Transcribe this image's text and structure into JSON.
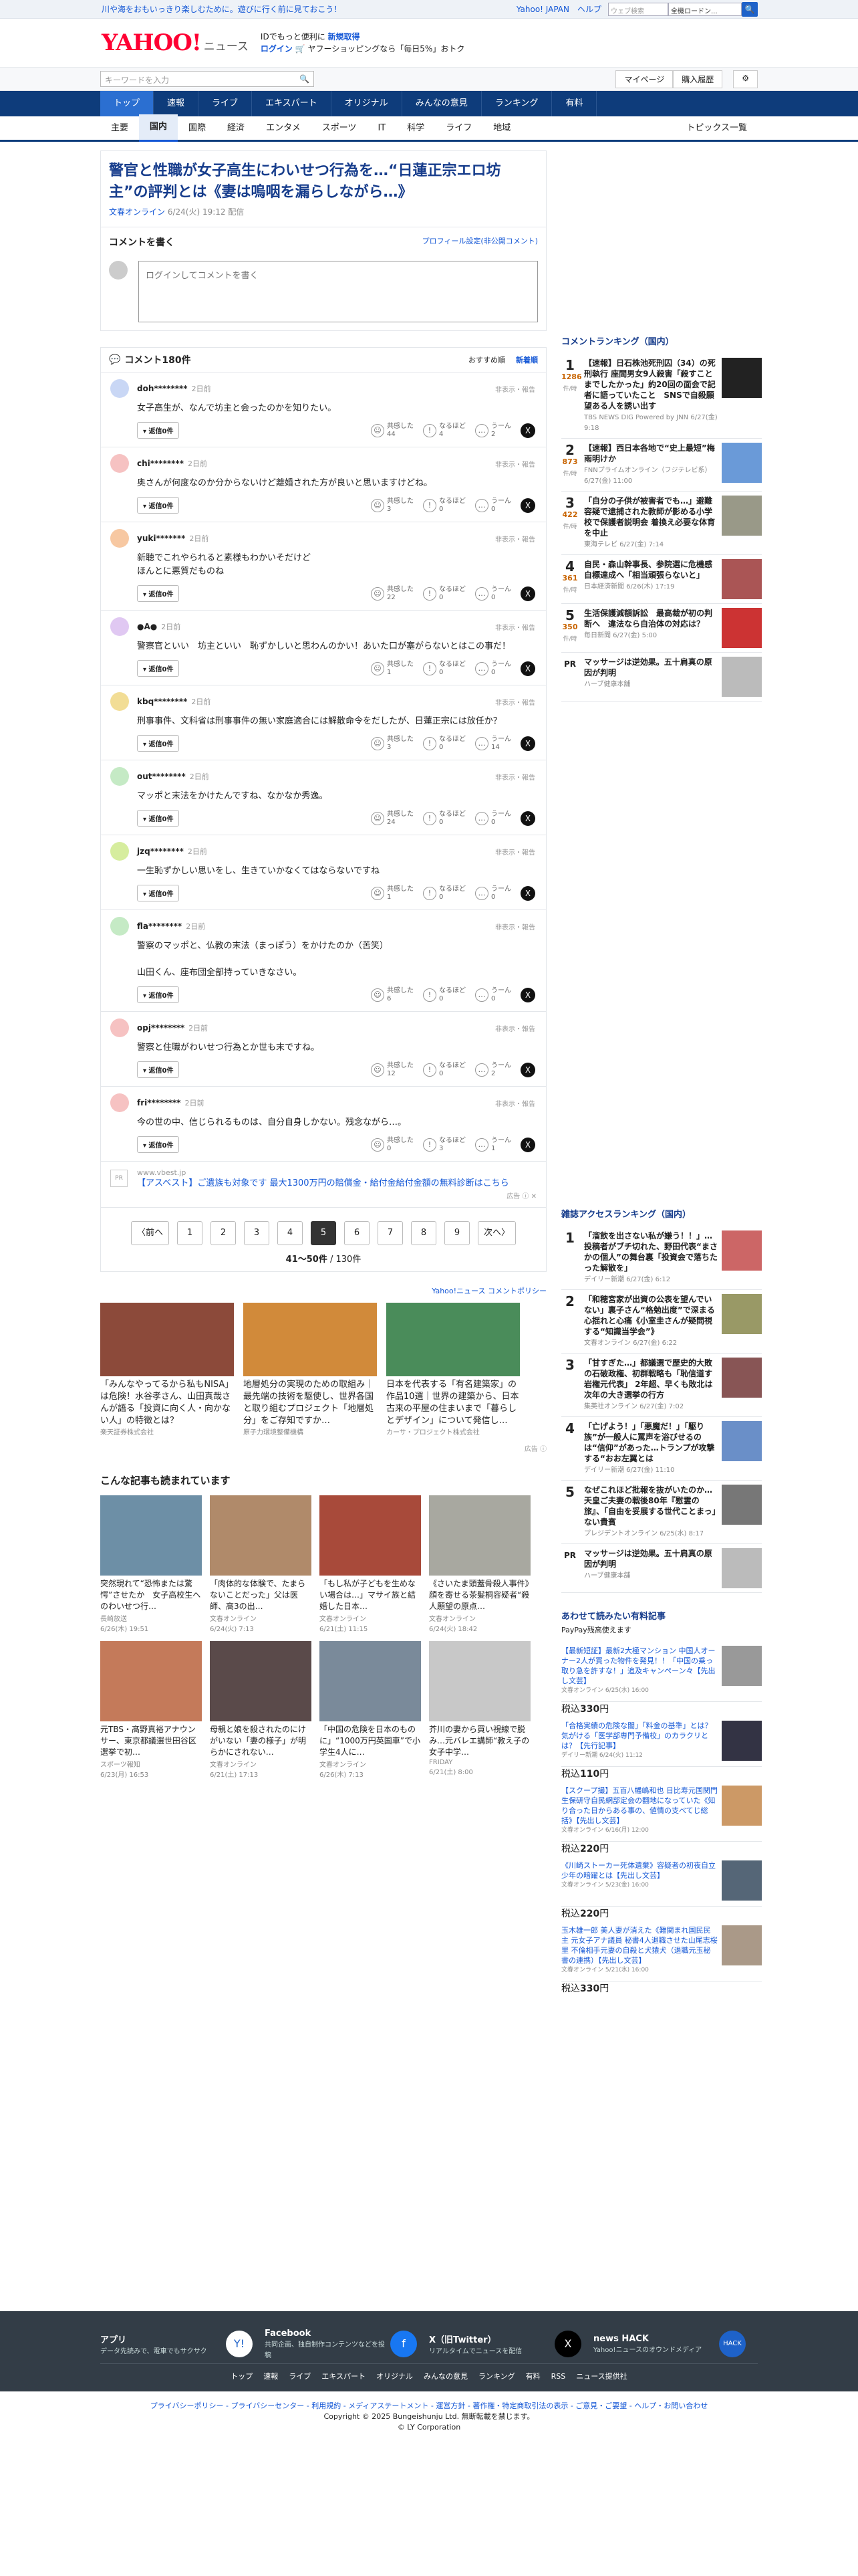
{
  "topbar": {
    "promo": "川や海をおもいっきり楽しむために。遊びに行く前に見ておこう！",
    "links": [
      "Yahoo! JAPAN",
      "ヘルプ"
    ],
    "search_placeholder": "ウェブ検索",
    "select": "全機ロードン...",
    "btn": "🔍"
  },
  "header": {
    "logo": "YAHOO!",
    "logo_sub": "JAPAN",
    "service": "ニュース",
    "line1a": "IDでもっと便利に",
    "line1b": "新規取得",
    "line2a": "ログイン",
    "line2b": "🛒 ヤフーショッピングなら「毎日5%」おトク"
  },
  "searchbar": {
    "placeholder": "キーワードを入力",
    "right": [
      "マイページ",
      "購入履歴",
      "⚙"
    ]
  },
  "gnav": [
    "トップ",
    "速報",
    "ライブ",
    "エキスパート",
    "オリジナル",
    "みんなの意見",
    "ランキング",
    "有料"
  ],
  "snav": [
    "主要",
    "国内",
    "国際",
    "経済",
    "エンタメ",
    "スポーツ",
    "IT",
    "科学",
    "ライフ",
    "地域"
  ],
  "snav_right": "トピックス一覧",
  "article": {
    "title": "警官と性職が女子高生にわいせつ行為を…“日蓮正宗エロ坊主”の評判とは《妻は嗚咽を漏らしながら…》",
    "source": "文春オンライン",
    "date": "6/24(火) 19:12 配信"
  },
  "comment_write": {
    "title": "コメントを書く",
    "profile": "プロフィール設定(非公開コメント)",
    "placeholder": "ログインしてコメントを書く"
  },
  "comments_header": {
    "title": "コメント180件",
    "sort1": "おすすめ順",
    "sort2": "新着順"
  },
  "comments": [
    {
      "user": "doh********",
      "time": "2日前",
      "body": "女子高生が、なんで坊主と会ったのかを知りたい。",
      "likes": "44",
      "agree": "4",
      "hmm": "2",
      "color": "#c9d7f5"
    },
    {
      "user": "chi********",
      "time": "2日前",
      "body": "奥さんが何度なのか分からないけど離婚された方が良いと思いますけどね。",
      "likes": "3",
      "agree": "0",
      "hmm": "0",
      "color": "#f6c2c2"
    },
    {
      "user": "yuki*******",
      "time": "2日前",
      "body": "新聴でこれやられると素様もわかいそだけど\nほんとに悪質だものね",
      "likes": "22",
      "agree": "0",
      "hmm": "0",
      "color": "#f7c8a2"
    },
    {
      "user": "●A●",
      "time": "2日前",
      "body": "警察官といい　坊主といい　恥ずかしいと思わんのかい！あいた口が塞がらないとはこの事だ！",
      "likes": "1",
      "agree": "0",
      "hmm": "0",
      "color": "#e0c8f2"
    },
    {
      "user": "kbq********",
      "time": "2日前",
      "body": "刑事事件、文科省は刑事事件の無い家庭適合には解散命令をだしたが、日蓮正宗には放任か？",
      "likes": "3",
      "agree": "0",
      "hmm": "14",
      "color": "#f2dd95"
    },
    {
      "user": "out********",
      "time": "2日前",
      "body": "マッポと末法をかけたんですね、なかなか秀逸。",
      "likes": "24",
      "agree": "0",
      "hmm": "0",
      "color": "#c5eac5"
    },
    {
      "user": "jzq********",
      "time": "2日前",
      "body": "一生恥ずかしい思いをし、生きていかなくてはならないですね",
      "likes": "1",
      "agree": "0",
      "hmm": "0",
      "color": "#d6ed9e"
    },
    {
      "user": "fla********",
      "time": "2日前",
      "body": "警察のマッポと、仏教の末法（まっぽう）をかけたのか（苦笑）\n\n山田くん、座布団全部持っていきなさい。",
      "likes": "6",
      "agree": "0",
      "hmm": "0",
      "color": "#c5eac5"
    },
    {
      "user": "opj********",
      "time": "2日前",
      "body": "警察と住職がわいせつ行為とか世も末ですね。",
      "likes": "12",
      "agree": "0",
      "hmm": "2",
      "color": "#f6c2c2"
    },
    {
      "user": "fri********",
      "time": "2日前",
      "body": "今の世の中、信じられるものは、自分自身しかない。残念ながら…。",
      "likes": "0",
      "agree": "3",
      "hmm": "1",
      "color": "#f6c2c2"
    }
  ],
  "comment_ui": {
    "reply": "返信0件",
    "report": "非表示・報告",
    "like": "共感した",
    "agree": "なるほど",
    "hmm": "うーん",
    "x": "X"
  },
  "ad1": {
    "pr": "PR",
    "domain": "www.vbest.jp",
    "title": "【アスベスト】ご遺族も対象です 最大1300万円の賠償金・給付金給付金額の無料診断はこちら",
    "label": "広告 ⓘ ✕"
  },
  "pager": {
    "pages": [
      "〈前へ",
      "1",
      "2",
      "3",
      "4",
      "5",
      "6",
      "7",
      "8",
      "9",
      "次へ〉"
    ],
    "current": "5",
    "count_a": "41〜50件",
    "count_b": " / 130件"
  },
  "policy": "Yahoo!ニュース コメントポリシー",
  "ads": [
    {
      "title": "「みんなやってるから私もNISA」は危険！水谷孝さん、山田真哉さんが語る「投資に向く人・向かない人」の特徴とは？",
      "src": "楽天証券株式会社",
      "c": "#8c4a3a"
    },
    {
      "title": "地層処分の実現のための取組み｜最先端の技術を駆使し、世界各国と取り組むプロジェクト「地層処分」をご存知ですか…",
      "src": "原子力環境整備機構",
      "c": "#d18a3a"
    },
    {
      "title": "日本を代表する「有名建築家」の作品10選｜世界の建築から、日本古来の平屋の住まいまで「暮らしとデザイン」について発信し…",
      "src": "カーサ・プロジェクト株式会社",
      "c": "#4a8c5a"
    }
  ],
  "ads_label": "広告 ⓘ",
  "related_title": "こんな記事も読まれています",
  "related": [
    {
      "t": "突然現れて“恐怖または驚愕”させたか　女子高校生へのわいせつ行…",
      "s": "長崎放送",
      "d": "6/26(木) 19:51",
      "c": "#6d8fa6"
    },
    {
      "t": "「肉体的な体験で、たまらないことだった」父は医師、高3の出…",
      "s": "文春オンライン",
      "d": "6/24(火) 7:13",
      "c": "#b08a6a"
    },
    {
      "t": "「もし私が子どもを生めない場合は…」マサイ族と結婚した日本…",
      "s": "文春オンライン",
      "d": "6/21(土) 11:15",
      "c": "#a84a3a"
    },
    {
      "t": "《さいたま頭蓋骨殺人事件》顔を寄せる茶髪桐容疑者“殺人願望の原点…",
      "s": "文春オンライン",
      "d": "6/24(火) 18:42",
      "c": "#a8a8a0"
    },
    {
      "t": "元TBS・髙野真裕アナウンサー、東京都議選世田谷区選挙で初…",
      "s": "スポーツ報知",
      "d": "6/23(月) 16:53",
      "c": "#c47a5a"
    },
    {
      "t": "母親と娘を殺されたのにけがいない「妻の様子」が明らかにされない…",
      "s": "文春オンライン",
      "d": "6/21(土) 17:13",
      "c": "#5a4a4a"
    },
    {
      "t": "「中国の危険を日本のものに」“1000万円英国車”で小学生4人に…",
      "s": "文春オンライン",
      "d": "6/26(木) 7:13",
      "c": "#7a8a9a"
    },
    {
      "t": "芥川の妻から買い視線で脱み…元バレエ講師“教え子の女子中学…",
      "s": "FRIDAY",
      "d": "6/21(土) 8:00",
      "c": "#c8c8c8"
    }
  ],
  "rank1": {
    "title": "コメントランキング（国内）",
    "items": [
      {
        "n": "1",
        "c": "1286",
        "u": "件/時",
        "t": "【速報】日石株池死刑囚（34）の死刑執行 座間男女9人殺害「殺すことまでしたかった」約20回の面会で記者に語っていたこと　SNSで自殺願望ある人を誘い出す",
        "s": "TBS NEWS DIG Powered by JNN 6/27(金) 9:18",
        "th": "#222"
      },
      {
        "n": "2",
        "c": "873",
        "u": "件/時",
        "t": "【速報】西日本各地で“史上最短”梅雨明けか",
        "s": "FNNプライムオンライン（フジテレビ系） 6/27(金) 11:00",
        "th": "#6a9ad8"
      },
      {
        "n": "3",
        "c": "422",
        "u": "件/時",
        "t": "「自分の子供が被害者でも…」避難容疑で逮捕された教師が影める小学校で保護者説明会 着換え必要な体育を中止",
        "s": "東海テレビ 6/27(金) 7:14",
        "th": "#998"
      },
      {
        "n": "4",
        "c": "361",
        "u": "件/時",
        "t": "自民・森山幹事長、参院選に危機感　自標達成へ「相当頑張らないと」",
        "s": "日本経済新聞 6/26(木) 17:19",
        "th": "#a55"
      },
      {
        "n": "5",
        "c": "350",
        "u": "件/時",
        "t": "生活保護減額訴訟　最高裁が初の判断へ　違法なら自治体の対応は？",
        "s": "毎日新聞 6/27(金) 5:00",
        "th": "#c33"
      }
    ],
    "pr": {
      "t": "マッサージは逆効果。五十肩真の原因が判明",
      "s": "ハーブ健康本舗",
      "th": "#bbb"
    }
  },
  "rank2": {
    "title": "雑誌アクセスランキング（国内）",
    "items": [
      {
        "n": "1",
        "t": "「溜飲を出さない私が嫌う！！」…投稿者がブチ切れた、野田代表“まさかの個人”の舞台裏「投資会で落ちたった解散を」",
        "s": "デイリー新潮 6/27(金) 6:12",
        "th": "#c66"
      },
      {
        "n": "2",
        "t": "「和穂宮家が出資の公表を望んでいない」裏子さん“格勉出度”で深まる心揺れと心痛《小室圭さんが疑問視する“知識当学会”》",
        "s": "文春オンライン 6/27(金) 6:22",
        "th": "#996"
      },
      {
        "n": "3",
        "t": "「甘すぎた…」都議選で歴史的大敗の石破政権、初群戦略も「恥信道す岩権元代表」 2年超、早くも敗北は次年の大き選挙の行方",
        "s": "集英社オンライン 6/27(金) 7:02",
        "th": "#855"
      },
      {
        "n": "4",
        "t": "「亡げよう！」「悪魔だ！」「駆り族”が一般人に罵声を浴びせるのは“信仰”があった…トランプが攻撃する“おお左翼とは",
        "s": "デイリー新潮 6/27(金) 11:10",
        "th": "#6a8fc8"
      },
      {
        "n": "5",
        "t": "なぜこれほど批報を抜がいたのか…天皇ご夫妻の戦後80年『慰霊の旅』、「自由を妥展する世代ことまっ」ない貴賓",
        "s": "プレジデントオンライン 6/25(水) 8:17",
        "th": "#777"
      }
    ],
    "pr": {
      "t": "マッサージは逆効果。五十肩真の原因が判明",
      "s": "ハーブ健康本舗",
      "th": "#bbb"
    }
  },
  "recs": {
    "title": "あわせて読みたい有料記事",
    "sub": "PayPay残高使えます",
    "items": [
      {
        "t": "【最新短証】最新2大極マンション 中国人オーナー2人が買った物件を発見！！「中国の乗っ取り急を許すな！」追及キャンペーン々【先出し文芸】",
        "s": "文春オンライン 6/25(水) 16:00",
        "p": "330",
        "c": "#999"
      },
      {
        "t": "「合格実績の危険な闇」「料金の基準」とは？　気がける「医学部専門予備校」のカラクリとは？【先行記事】",
        "s": "デイリー新潮 6/24(火) 11:12",
        "p": "110",
        "c": "#334"
      },
      {
        "t": "【スクープ撮】五百八幡嶋和也 日比寿元国関門生保研守自民網部定会の翻地になっていた《知り合った日からある事の、値情の支べてじ総括》【先出し文芸】",
        "s": "文春オンライン 6/16(月) 12:00",
        "p": "220",
        "c": "#c96"
      },
      {
        "t": "《川崎ストーカー死体遺棄》容疑者の初夜自立少年の暗躍とは【先出し文芸】",
        "s": "文春オンライン 5/23(金) 16:00",
        "p": "220",
        "c": "#567"
      },
      {
        "t": "玉木雄一郎 美人妻が消えた《難関まれ国民民主 元女子アナ議員 秘書4人退職させた山尾志桜里 不倫相手元妻の自殺と犬猿犬（退職元玉秘書の連携）【先出し文芸】",
        "s": "文春オンライン 5/21(水) 16:00",
        "p": "330",
        "c": "#a98"
      }
    ],
    "price_label": "税込",
    "yen": "円"
  },
  "footer": {
    "apps": [
      {
        "t": "アプリ",
        "s": "データ先読みで、電車でもサクサク",
        "ic": "Y!"
      },
      {
        "t": "Facebook",
        "s": "共同企画、独自制作コンテンツなどを投稿",
        "ic": "f"
      },
      {
        "t": "X（旧Twitter）",
        "s": "リアルタイムでニュースを配信",
        "ic": "X"
      },
      {
        "t": "news HACK",
        "s": "Yahoo!ニュースのオウンドメディア",
        "ic": "HACK"
      }
    ],
    "links": [
      "トップ",
      "速報",
      "ライブ",
      "エキスパート",
      "オリジナル",
      "みんなの意見",
      "ランキング",
      "有料",
      "RSS",
      "ニュース提供社"
    ],
    "bottom_links": "プライバシーポリシー - プライバシーセンター - 利用規約 - メディアステートメント - 運営方針 - 著作権・特定商取引法の表示 - ご意見・ご要望 - ヘルプ・お問い合わせ",
    "copy1": "Copyright © 2025 Bungeishunju Ltd. 無断転載を禁じます。",
    "copy2": "© LY Corporation"
  }
}
